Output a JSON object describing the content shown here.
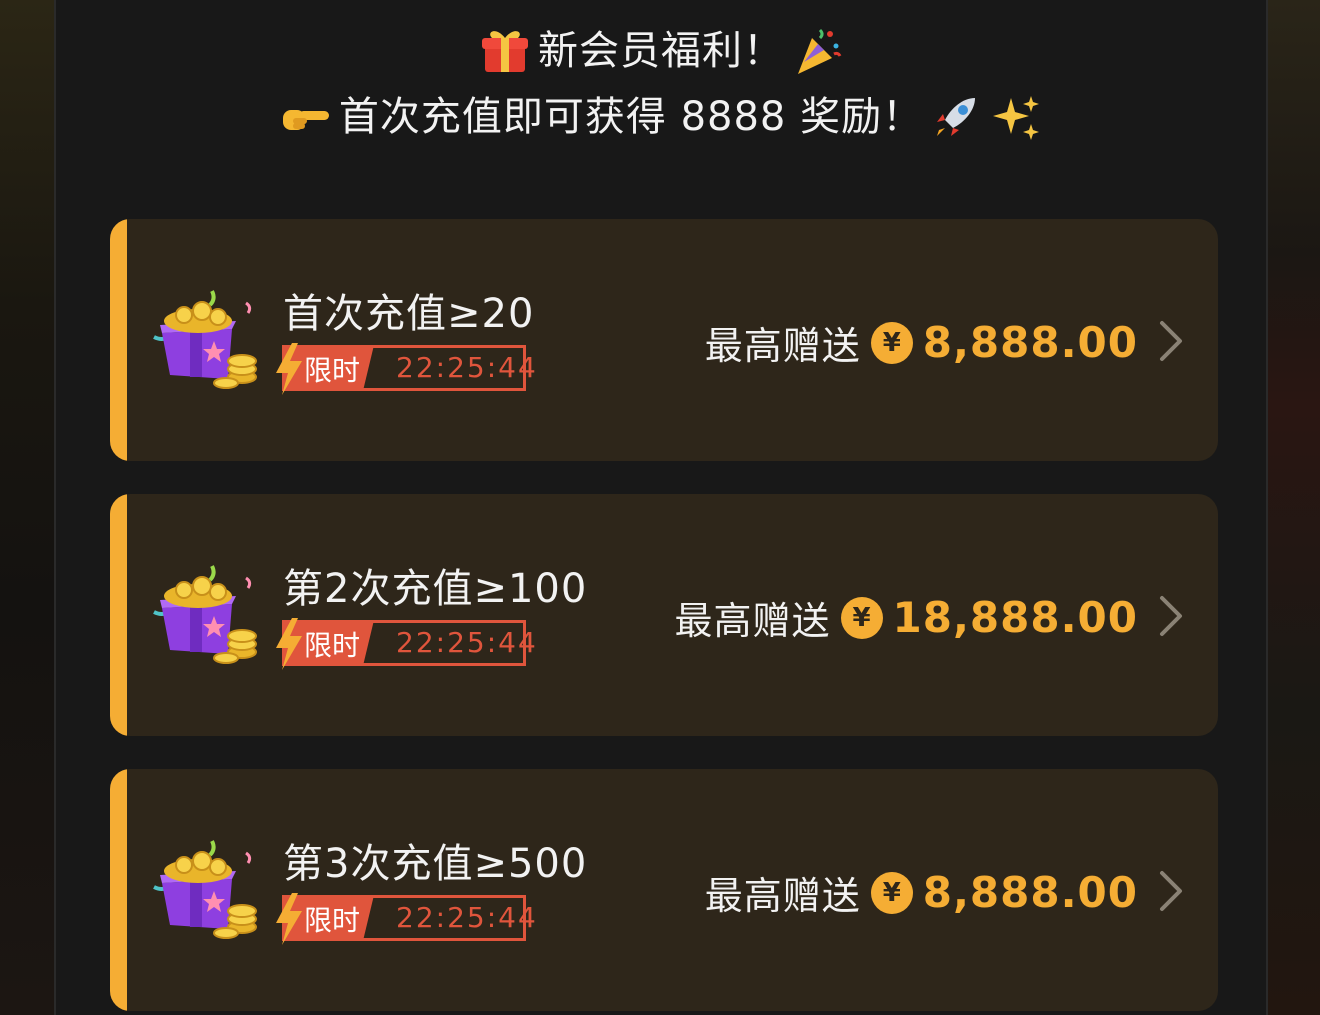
{
  "header": {
    "line1": "新会员福利！",
    "line2": "首次充值即可获得 8888 奖励！"
  },
  "offers": [
    {
      "title": "首次充值≥20",
      "tag": "限时",
      "countdown": "22:25:44",
      "reward_label": "最高赠送",
      "currency": "¥",
      "amount": "8,888.00"
    },
    {
      "title": "第2次充值≥100",
      "tag": "限时",
      "countdown": "22:25:44",
      "reward_label": "最高赠送",
      "currency": "¥",
      "amount": "18,888.00"
    },
    {
      "title": "第3次充值≥500",
      "tag": "限时",
      "countdown": "22:25:44",
      "reward_label": "最高赠送",
      "currency": "¥",
      "amount": "8,888.00"
    }
  ],
  "icons": {
    "header_left_1": "gift-icon",
    "header_right_1": "party-popper-icon",
    "header_left_2": "pointing-hand-icon",
    "header_right_2": "rocket-icon",
    "header_right_3": "sparkles-icon",
    "offer_image": "treasure-gift-box-icon",
    "timer": "lightning-bolt-icon",
    "navigate": "chevron-right-icon"
  },
  "colors": {
    "panel_bg": "#181818",
    "card_bg": "#2e261a",
    "accent": "#f5ad34",
    "timer_red": "#e0553c",
    "text": "#f2f2f2"
  }
}
